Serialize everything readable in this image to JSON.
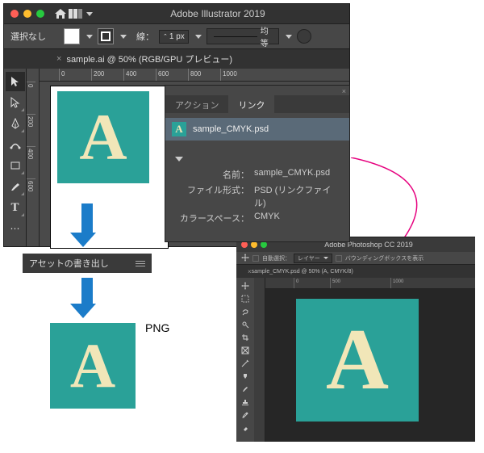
{
  "illustrator": {
    "title": "Adobe Illustrator 2019",
    "selection_label": "選択なし",
    "stroke_label": "線：",
    "stroke_value": "1 px",
    "uniform_label": "均等",
    "doc_tab": "sample.ai @ 50% (RGB/GPU プレビュー)",
    "ruler_h": [
      "0",
      "200",
      "400",
      "600",
      "800",
      "1000"
    ],
    "ruler_v": [
      "0",
      "200",
      "400",
      "600"
    ],
    "glyph": "A"
  },
  "panel": {
    "tab_actions": "アクション",
    "tab_links": "リンク",
    "link_name": "sample_CMYK.psd",
    "thumb_glyph": "A",
    "info": {
      "name_label": "名前：",
      "name_val": "sample_CMYK.psd",
      "format_label": "ファイル形式：",
      "format_val": "PSD (リンクファイル)",
      "colorspace_label": "カラースペース：",
      "colorspace_val": "CMYK"
    }
  },
  "export_panel": "アセットの書き出し",
  "output": {
    "glyph": "A",
    "format_label": "PNG"
  },
  "photoshop": {
    "title": "Adobe Photoshop CC 2019",
    "auto_select": "自動選択：",
    "layer_dd": "レイヤー",
    "bounding": "バウンディングボックスを表示",
    "doc_tab": "sample_CMYK.psd @ 50% (A, CMYK/8)",
    "ruler_h": [
      "0",
      "500",
      "1000"
    ],
    "glyph": "A"
  }
}
